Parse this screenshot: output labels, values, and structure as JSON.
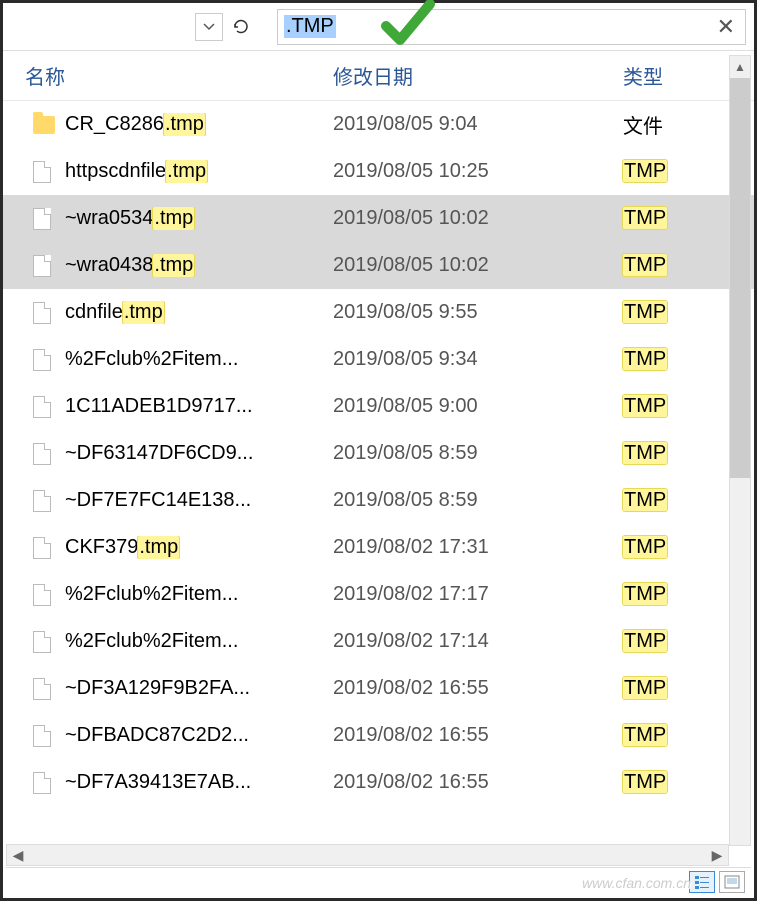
{
  "search": {
    "query": ".TMP",
    "close_label": "✕"
  },
  "columns": {
    "name": "名称",
    "date": "修改日期",
    "type": "类型"
  },
  "files": [
    {
      "icon": "folder",
      "name_pre": "CR_C8286",
      "name_hl": ".tmp",
      "name_post": "",
      "date": "2019/08/05 9:04",
      "type_pre": "文件",
      "type_hl": "",
      "selected": false
    },
    {
      "icon": "file",
      "name_pre": "httpscdnfile",
      "name_hl": ".tmp",
      "name_post": "",
      "date": "2019/08/05 10:25",
      "type_pre": "",
      "type_hl": "TMP",
      "selected": false
    },
    {
      "icon": "file",
      "name_pre": "~wra0534",
      "name_hl": ".tmp",
      "name_post": "",
      "date": "2019/08/05 10:02",
      "type_pre": "",
      "type_hl": "TMP",
      "selected": true
    },
    {
      "icon": "file",
      "name_pre": "~wra0438",
      "name_hl": ".tmp",
      "name_post": "",
      "date": "2019/08/05 10:02",
      "type_pre": "",
      "type_hl": "TMP",
      "selected": true
    },
    {
      "icon": "file",
      "name_pre": "cdnfile",
      "name_hl": ".tmp",
      "name_post": "",
      "date": "2019/08/05 9:55",
      "type_pre": "",
      "type_hl": "TMP",
      "selected": false
    },
    {
      "icon": "file",
      "name_pre": "%2Fclub%2Fitem...",
      "name_hl": "",
      "name_post": "",
      "date": "2019/08/05 9:34",
      "type_pre": "",
      "type_hl": "TMP",
      "selected": false
    },
    {
      "icon": "file",
      "name_pre": "1C11ADEB1D9717...",
      "name_hl": "",
      "name_post": "",
      "date": "2019/08/05 9:00",
      "type_pre": "",
      "type_hl": "TMP",
      "selected": false
    },
    {
      "icon": "file",
      "name_pre": "~DF63147DF6CD9...",
      "name_hl": "",
      "name_post": "",
      "date": "2019/08/05 8:59",
      "type_pre": "",
      "type_hl": "TMP",
      "selected": false
    },
    {
      "icon": "file",
      "name_pre": "~DF7E7FC14E138...",
      "name_hl": "",
      "name_post": "",
      "date": "2019/08/05 8:59",
      "type_pre": "",
      "type_hl": "TMP",
      "selected": false
    },
    {
      "icon": "file",
      "name_pre": "CKF379",
      "name_hl": ".tmp",
      "name_post": "",
      "date": "2019/08/02 17:31",
      "type_pre": "",
      "type_hl": "TMP",
      "selected": false
    },
    {
      "icon": "file",
      "name_pre": "%2Fclub%2Fitem...",
      "name_hl": "",
      "name_post": "",
      "date": "2019/08/02 17:17",
      "type_pre": "",
      "type_hl": "TMP",
      "selected": false
    },
    {
      "icon": "file",
      "name_pre": "%2Fclub%2Fitem...",
      "name_hl": "",
      "name_post": "",
      "date": "2019/08/02 17:14",
      "type_pre": "",
      "type_hl": "TMP",
      "selected": false
    },
    {
      "icon": "file",
      "name_pre": "~DF3A129F9B2FA...",
      "name_hl": "",
      "name_post": "",
      "date": "2019/08/02 16:55",
      "type_pre": "",
      "type_hl": "TMP",
      "selected": false
    },
    {
      "icon": "file",
      "name_pre": "~DFBADC87C2D2...",
      "name_hl": "",
      "name_post": "",
      "date": "2019/08/02 16:55",
      "type_pre": "",
      "type_hl": "TMP",
      "selected": false
    },
    {
      "icon": "file",
      "name_pre": "~DF7A39413E7AB...",
      "name_hl": "",
      "name_post": "",
      "date": "2019/08/02 16:55",
      "type_pre": "",
      "type_hl": "TMP",
      "selected": false
    }
  ],
  "watermark": "www.cfan.com.cn"
}
